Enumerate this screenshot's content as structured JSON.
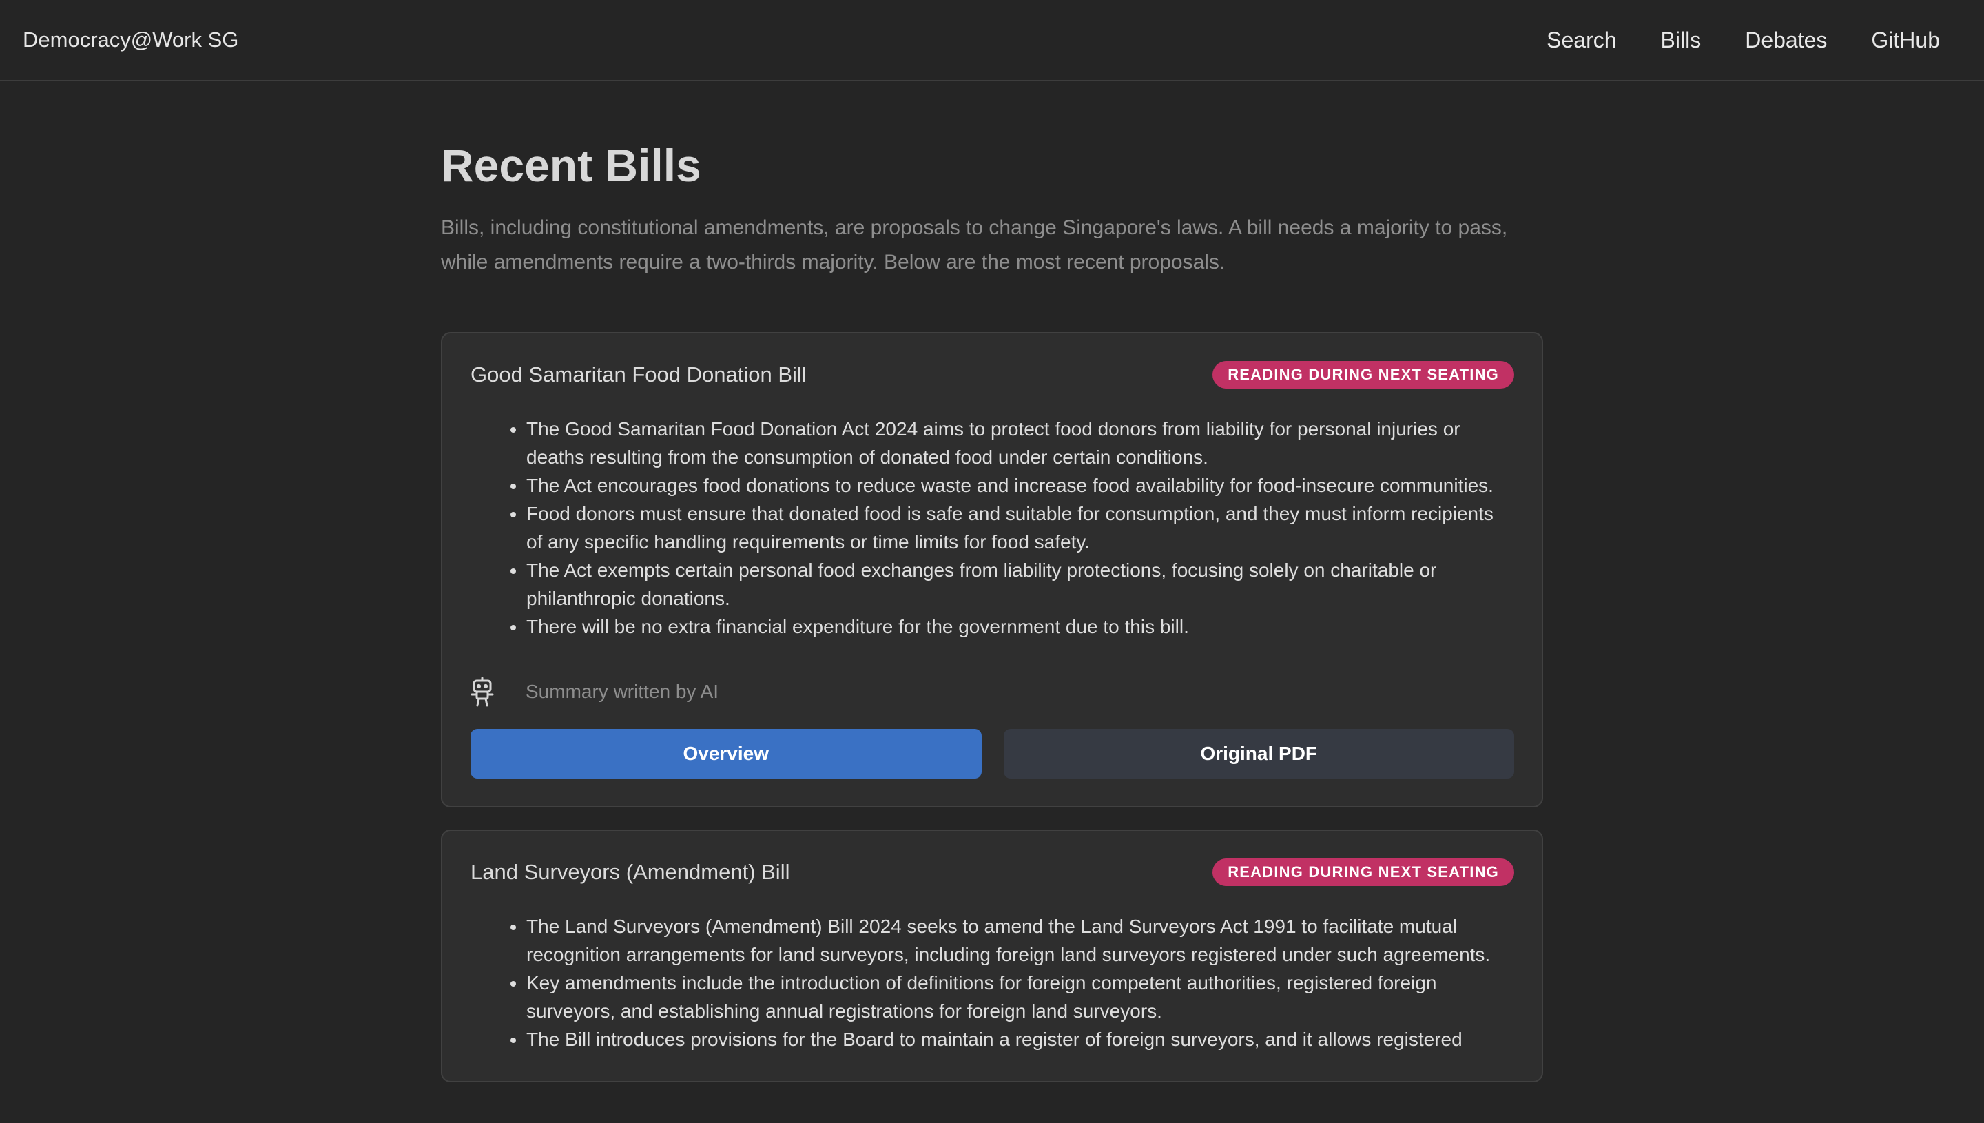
{
  "navbar": {
    "brand": "Democracy@Work SG",
    "links": [
      "Search",
      "Bills",
      "Debates",
      "GitHub"
    ]
  },
  "page": {
    "title": "Recent Bills",
    "description": "Bills, including constitutional amendments, are proposals to change Singapore's laws. A bill needs a majority to pass, while amendments require a two-thirds majority. Below are the most recent proposals."
  },
  "bills": [
    {
      "title": "Good Samaritan Food Donation Bill",
      "status": "READING DURING NEXT SEATING",
      "summary": [
        "The Good Samaritan Food Donation Act 2024 aims to protect food donors from liability for personal injuries or deaths resulting from the consumption of donated food under certain conditions.",
        "The Act encourages food donations to reduce waste and increase food availability for food-insecure communities.",
        "Food donors must ensure that donated food is safe and suitable for consumption, and they must inform recipients of any specific handling requirements or time limits for food safety.",
        "The Act exempts certain personal food exchanges from liability protections, focusing solely on charitable or philanthropic donations.",
        "There will be no extra financial expenditure for the government due to this bill."
      ],
      "ai_note": "Summary written by AI",
      "ai_icon": "robot-icon",
      "overview_label": "Overview",
      "pdf_label": "Original PDF"
    },
    {
      "title": "Land Surveyors (Amendment) Bill",
      "status": "READING DURING NEXT SEATING",
      "summary": [
        "The Land Surveyors (Amendment) Bill 2024 seeks to amend the Land Surveyors Act 1991 to facilitate mutual recognition arrangements for land surveyors, including foreign land surveyors registered under such agreements.",
        "Key amendments include the introduction of definitions for foreign competent authorities, registered foreign surveyors, and establishing annual registrations for foreign land surveyors.",
        "The Bill introduces provisions for the Board to maintain a register of foreign surveyors, and it allows registered"
      ]
    }
  ],
  "colors": {
    "background": "#252525",
    "card": "#2e2e2e",
    "badge": "#c13164",
    "primary_button": "#3a71c4",
    "secondary_button": "#363a43"
  }
}
